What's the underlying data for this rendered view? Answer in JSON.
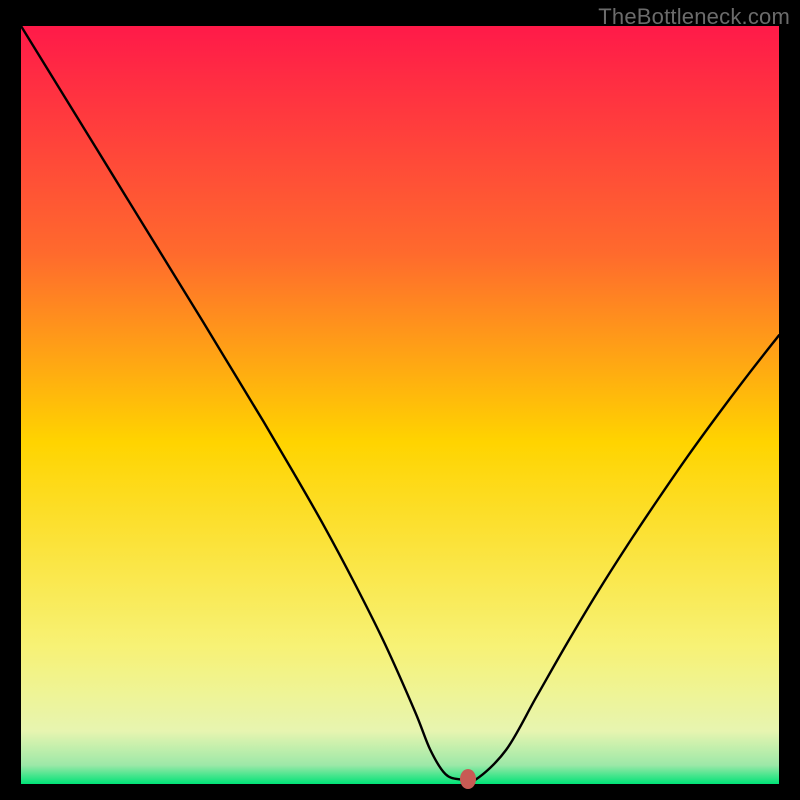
{
  "watermark": "TheBottleneck.com",
  "colors": {
    "top": "#ff1a49",
    "mid_upper": "#ff8a2a",
    "mid": "#ffd400",
    "mid_lower": "#f7f276",
    "near_bottom": "#e7f5b0",
    "bottom": "#00e377",
    "curve": "#000000",
    "marker": "#c85a54",
    "frame_bg": "#000000"
  },
  "chart_data": {
    "type": "line",
    "title": "",
    "xlabel": "",
    "ylabel": "",
    "xlim": [
      0,
      100
    ],
    "ylim": [
      0,
      100
    ],
    "x": [
      0,
      4,
      8,
      12,
      16,
      20,
      24,
      28,
      32,
      36,
      40,
      44,
      48,
      52,
      54,
      56,
      58,
      60,
      64,
      68,
      72,
      76,
      80,
      84,
      88,
      92,
      96,
      100
    ],
    "values": [
      100,
      93.5,
      87,
      80.5,
      74,
      67.5,
      61,
      54.4,
      47.8,
      41,
      34,
      26.5,
      18.5,
      9.5,
      4.5,
      1.3,
      0.6,
      0.6,
      4.5,
      11.5,
      18.5,
      25.2,
      31.5,
      37.5,
      43.3,
      48.8,
      54.1,
      59.2
    ],
    "marker": {
      "x": 59,
      "y": 0.6
    },
    "legend": [],
    "grid": false,
    "background_gradient_stops": [
      {
        "offset": 0.0,
        "color": "#ff1a49"
      },
      {
        "offset": 0.3,
        "color": "#ff6a2d"
      },
      {
        "offset": 0.55,
        "color": "#ffd400"
      },
      {
        "offset": 0.82,
        "color": "#f7f276"
      },
      {
        "offset": 0.93,
        "color": "#e7f5b0"
      },
      {
        "offset": 0.975,
        "color": "#9de8a8"
      },
      {
        "offset": 1.0,
        "color": "#00e377"
      }
    ]
  }
}
